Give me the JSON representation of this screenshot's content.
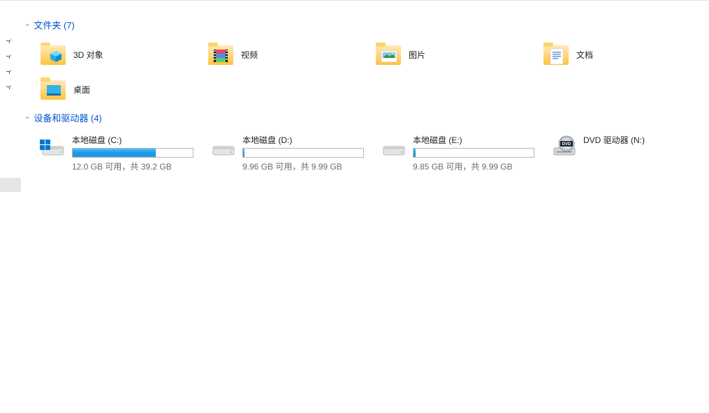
{
  "groups": {
    "folders": {
      "title": "文件夹",
      "count": 7,
      "label": "文件夹 (7)"
    },
    "drives": {
      "title": "设备和驱动器",
      "count": 4,
      "label": "设备和驱动器 (4)"
    }
  },
  "folders": [
    {
      "label": "3D 对象"
    },
    {
      "label": "视频"
    },
    {
      "label": "图片"
    },
    {
      "label": "文档"
    },
    {
      "label": "桌面"
    }
  ],
  "drives": [
    {
      "name": "本地磁盘 (C:)",
      "stats": "12.0 GB 可用，共 39.2 GB",
      "fill": 69,
      "os": true
    },
    {
      "name": "本地磁盘 (D:)",
      "stats": "9.96 GB 可用，共 9.99 GB",
      "fill": 1,
      "os": false
    },
    {
      "name": "本地磁盘 (E:)",
      "stats": "9.85 GB 可用，共 9.99 GB",
      "fill": 2,
      "os": false
    },
    {
      "name": "DVD 驱动器 (N:)",
      "stats": "",
      "fill": null,
      "dvd": true
    }
  ]
}
